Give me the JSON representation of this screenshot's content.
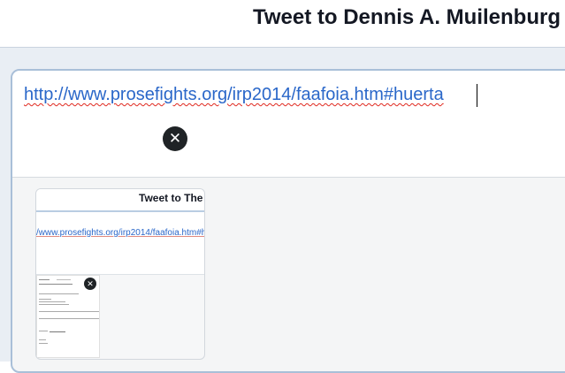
{
  "header": {
    "title": "Tweet to Dennis A. Muilenburg"
  },
  "composer": {
    "text": "http://www.prosefights.org/irp2014/faafoia.htm#huerta"
  },
  "attachment": {
    "preview_title": "Tweet to The",
    "preview_url": "/www.prosefights.org/irp2014/faafoia.htm#h",
    "remove_icon": "close-icon",
    "remove_glyph": "✕"
  }
}
